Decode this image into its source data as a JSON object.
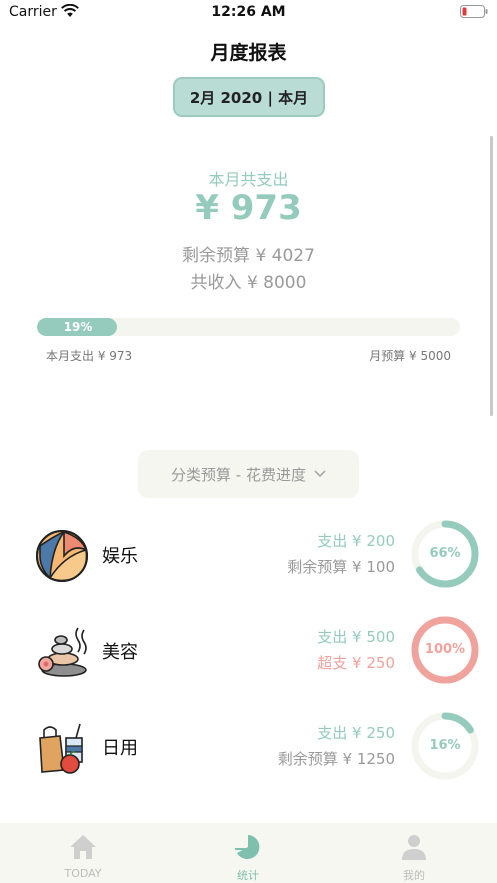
{
  "status_bar": {
    "carrier": "Carrier",
    "time": "12:26 AM"
  },
  "header": {
    "title": "月度报表"
  },
  "month_selector": {
    "label": "2月 2020 | 本月"
  },
  "summary": {
    "label": "本月共支出",
    "amount": "¥ 973",
    "remaining": "剩余预算 ¥ 4027",
    "income": "共收入 ¥ 8000"
  },
  "progress": {
    "percent_label": "19%",
    "fraction": 0.19,
    "spent_caption": "本月支出 ¥ 973",
    "budget_caption": "月预算 ¥ 5000"
  },
  "category_selector": {
    "label": "分类预算 - 花费进度"
  },
  "categories": [
    {
      "name": "娱乐",
      "icon": "beach-ball-icon",
      "spent": "支出 ¥ 200",
      "remain": "剩余预算 ¥ 100",
      "over": false,
      "percent_label": "66%",
      "fraction": 0.66,
      "color": "#95cbbd"
    },
    {
      "name": "美容",
      "icon": "spa-stones-icon",
      "spent": "支出 ¥ 500",
      "remain": "超支 ¥ 250",
      "over": true,
      "percent_label": "100%",
      "fraction": 1.0,
      "color": "#f0a39c"
    },
    {
      "name": "日用",
      "icon": "grocery-bag-icon",
      "spent": "支出 ¥ 250",
      "remain": "剩余预算 ¥ 1250",
      "over": false,
      "percent_label": "16%",
      "fraction": 0.16,
      "color": "#95cbbd"
    }
  ],
  "tabbar": {
    "tabs": [
      {
        "label": "TODAY",
        "icon": "home-icon",
        "active": false
      },
      {
        "label": "统计",
        "icon": "pie-chart-icon",
        "active": true
      },
      {
        "label": "我的",
        "icon": "user-icon",
        "active": false
      }
    ]
  },
  "colors": {
    "accent": "#95cbbd",
    "warning": "#f0a39c",
    "muted": "#9a9a9a",
    "track": "#f5f5ef"
  }
}
